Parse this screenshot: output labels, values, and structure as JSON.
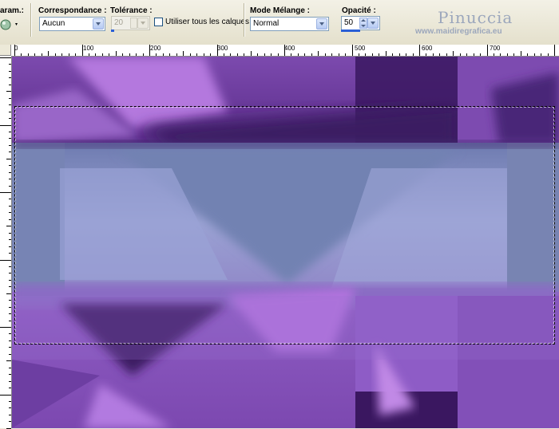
{
  "toolbar": {
    "param_label": "aram.:",
    "correspondance": {
      "label": "Correspondance :",
      "value": "Aucun"
    },
    "tolerance": {
      "label": "Tolérance :",
      "value": "20"
    },
    "all_layers": {
      "label": "Utiliser tous les calques",
      "checked": false
    },
    "blend_mode": {
      "label": "Mode Mélange :",
      "value": "Normal"
    },
    "opacity": {
      "label": "Opacité :",
      "value": "50"
    }
  },
  "watermark": {
    "title": "Pinuccia",
    "url": "www.maidiregrafica.eu"
  },
  "ruler": {
    "labels": [
      "0",
      "100",
      "200",
      "300",
      "400",
      "500",
      "600",
      "700"
    ]
  },
  "colors": {
    "accent": "#2a5fd6",
    "purple_dark": "#3a1760",
    "purple_light": "#b073dd",
    "blue_gray": "#8d94c8"
  }
}
